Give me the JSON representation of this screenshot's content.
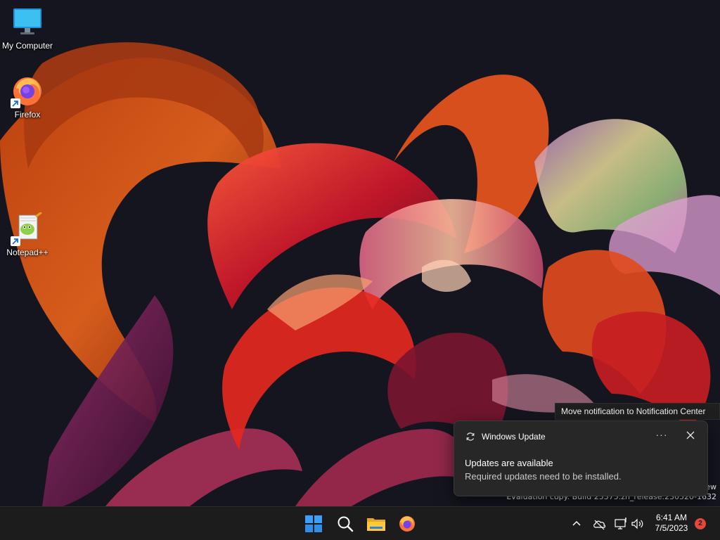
{
  "desktop": {
    "icons": [
      {
        "label": "My Computer",
        "icon": "monitor-icon"
      },
      {
        "label": "Firefox",
        "icon": "firefox-icon"
      },
      {
        "label": "Notepad++",
        "icon": "notepadpp-icon"
      }
    ],
    "watermark": {
      "line1": "ew",
      "line2": "Evaluation copy. Build 25375.zn_release.230520-1632"
    }
  },
  "notification": {
    "tooltip": "Move notification to Notification Center",
    "app_name": "Windows Update",
    "more_label": "···",
    "title": "Updates are available",
    "body": "Required updates need to be installed."
  },
  "taskbar": {
    "pinned": [
      "start-icon",
      "search-icon",
      "file-explorer-icon",
      "firefox-icon"
    ],
    "tray": [
      "chevron-up-icon",
      "cloud-offline-icon",
      "network-icon",
      "volume-icon"
    ],
    "clock": {
      "time": "6:41 AM",
      "date": "7/5/2023"
    },
    "notification_count": "2"
  },
  "colors": {
    "taskbar_bg": "#1c1c1c",
    "toast_bg": "#272727",
    "badge": "#e5473b",
    "start_blue": "#3aa0ff"
  }
}
